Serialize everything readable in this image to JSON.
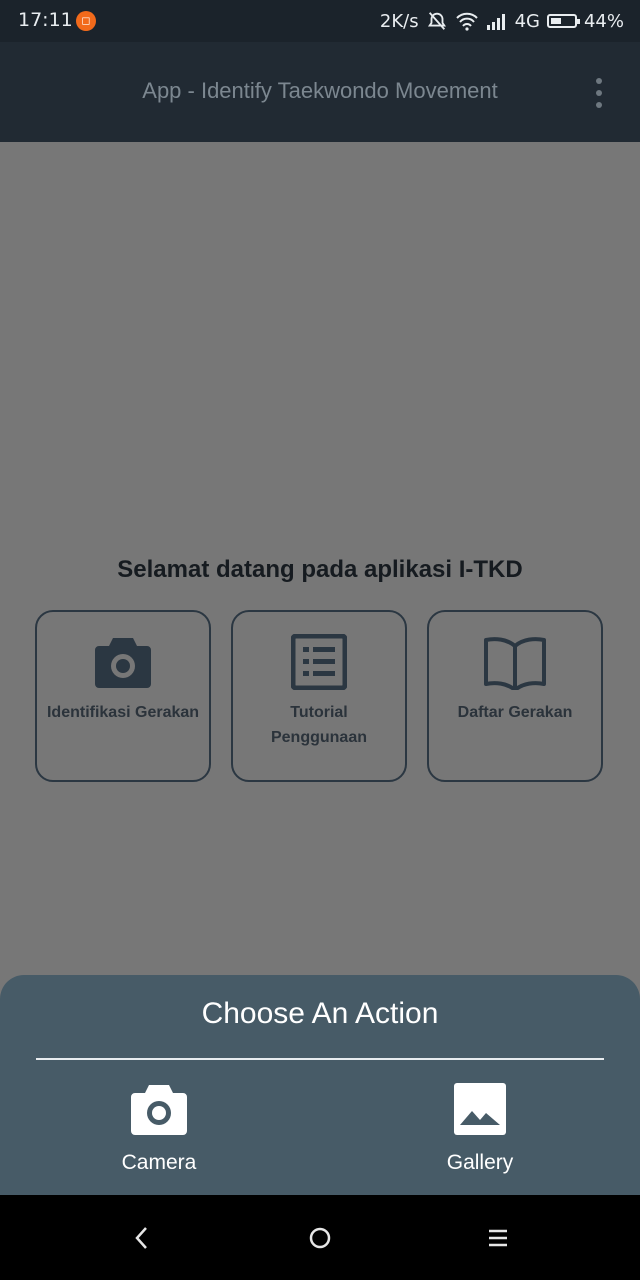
{
  "status_bar": {
    "time": "17:11",
    "network_speed": "2K/s",
    "network_type": "4G",
    "battery": "44%",
    "battery_level": 0.44,
    "notification_icon": "app-notification-icon"
  },
  "app_bar": {
    "title": "App - Identify Taekwondo Movement",
    "menu_icon": "more-vertical-icon"
  },
  "main": {
    "welcome": "Selamat datang pada aplikasi I-TKD",
    "cards": [
      {
        "label": "Identifikasi Gerakan",
        "icon": "camera-icon"
      },
      {
        "label": "Tutorial Penggunaan",
        "icon": "list-icon"
      },
      {
        "label": "Daftar Gerakan",
        "icon": "book-icon"
      }
    ]
  },
  "sheet": {
    "title": "Choose An Action",
    "actions": [
      {
        "label": "Camera",
        "icon": "camera-icon"
      },
      {
        "label": "Gallery",
        "icon": "image-icon"
      }
    ]
  },
  "nav_bar": {
    "back": "back-icon",
    "home": "home-icon",
    "recents": "recents-icon"
  },
  "colors": {
    "scrim": "#777777",
    "app_bar": "#212a33",
    "sheet": "#475b67",
    "card_border": "#2b3742"
  }
}
